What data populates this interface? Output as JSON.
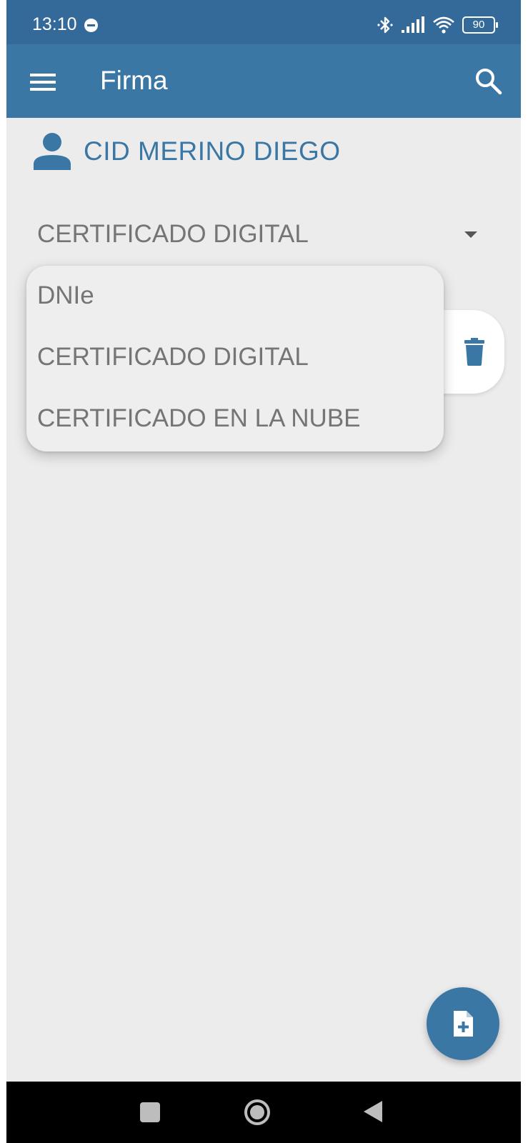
{
  "status_bar": {
    "time": "13:10",
    "battery": "90",
    "icons": [
      "notification-dot-icon",
      "bluetooth-icon",
      "signal-icon",
      "wifi-icon",
      "battery-icon"
    ]
  },
  "app_bar": {
    "title": "Firma",
    "menu_icon": "menu-icon",
    "search_icon": "search-icon"
  },
  "user": {
    "name": "CID MERINO DIEGO",
    "icon": "person-icon"
  },
  "signature_type": {
    "selected": "CERTIFICADO DIGITAL",
    "options": [
      "DNIe",
      "CERTIFICADO DIGITAL",
      "CERTIFICADO EN LA NUBE"
    ]
  },
  "card": {
    "action_icon": "trash-icon"
  },
  "fab": {
    "icon": "add-document-icon"
  },
  "nav_bar": {
    "icons": [
      "recent-apps-icon",
      "home-icon",
      "back-icon"
    ]
  },
  "colors": {
    "primary": "#3b77a5",
    "status_bar": "#346a9a",
    "background": "#ececec",
    "text_secondary": "#757575"
  }
}
